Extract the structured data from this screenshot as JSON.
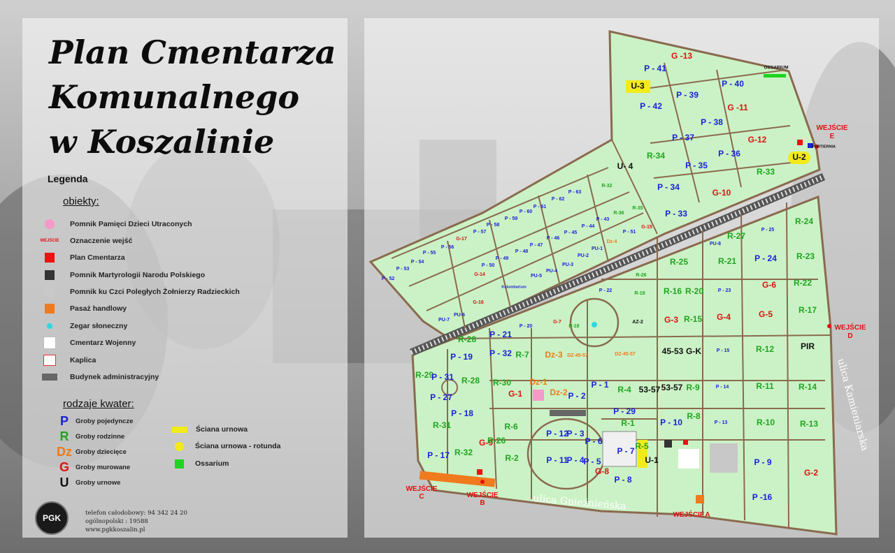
{
  "title": {
    "line1": "Plan Cmentarza",
    "line2": "Komunalnego",
    "line3": "w Koszalinie"
  },
  "legend": {
    "title": "Legenda",
    "objects_heading": "obiekty:",
    "objects": [
      {
        "symbol": "pink-circle",
        "color": "#f49ac8",
        "label": "Pomnik Pamięci Dzieci Utraconych"
      },
      {
        "symbol": "entrance-mark",
        "color": "#e01010",
        "text": "WEJŚCIE",
        "label": "Oznaczenie wejść"
      },
      {
        "symbol": "red-square",
        "color": "#ee1111",
        "label": "Plan Cmentarza"
      },
      {
        "symbol": "dark-square",
        "color": "#333333",
        "label": "Pomnik Martyrologii Narodu Polskiego"
      },
      {
        "symbol": "grey-square",
        "color": "#c8c8c8",
        "label": "Pomnik ku Czci Poległych Żołnierzy Radzieckich"
      },
      {
        "symbol": "orange-square",
        "color": "#f07a1e",
        "label": "Pasaż handlowy"
      },
      {
        "symbol": "cyan-dot",
        "color": "#2fd8e0",
        "label": "Zegar słoneczny"
      },
      {
        "symbol": "war-cemetery-icon",
        "color": "#ffffff",
        "label": "Cmentarz Wojenny"
      },
      {
        "symbol": "chapel-icon",
        "color": "#ffffff",
        "label": "Kaplica"
      },
      {
        "symbol": "admin-building",
        "color": "#666666",
        "label": "Budynek administracyjny"
      }
    ],
    "types_heading": "rodzaje kwater:",
    "types": [
      {
        "letter": "P",
        "color": "#1a22d8",
        "label": "Groby pojedyncze"
      },
      {
        "letter": "R",
        "color": "#1fa51f",
        "label": "Groby rodzinne"
      },
      {
        "letter": "Dz",
        "color": "#ee7a1a",
        "label": "Groby dziecięce"
      },
      {
        "letter": "G",
        "color": "#e01010",
        "label": "Groby murowane"
      },
      {
        "letter": "U",
        "color": "#111111",
        "label": "Groby urnowe"
      }
    ],
    "types_extra": [
      {
        "symbol": "yellow-bar",
        "color": "#f3ea1a",
        "label": "Ściana urnowa"
      },
      {
        "symbol": "yellow-circle",
        "color": "#f3ea1a",
        "label": "Ściana urnowa - rotunda"
      },
      {
        "symbol": "green-square",
        "color": "#1fd41f",
        "label": "Ossarium"
      }
    ]
  },
  "contact": {
    "logo": "PGK",
    "line1": "telefon całodobowy:  94 342 24 20",
    "line2": "ogólnopolski :  19588",
    "line3": "www.pgkkoszalin.pl"
  },
  "map": {
    "streets": [
      "ulica Gnieźnieńska",
      "ulica Kamieniarska"
    ],
    "entrances": [
      {
        "word": "WEJŚCIE",
        "letter": "A"
      },
      {
        "word": "WEJŚCIE",
        "letter": "B"
      },
      {
        "word": "WEJŚCIE",
        "letter": "C"
      },
      {
        "word": "WEJŚCIE",
        "letter": "D"
      },
      {
        "word": "WEJŚCIE",
        "letter": "E"
      }
    ],
    "places": [
      "OSSARIUM",
      "PORTIERNIA",
      "Kolumbarium"
    ],
    "quarters": [
      "G -13",
      "P - 41",
      "U-3",
      "P - 40",
      "P - 39",
      "P - 42",
      "G -11",
      "P - 38",
      "P - 37",
      "G-12",
      "U-2",
      "R-34",
      "P - 36",
      "P - 35",
      "U- 4",
      "R-33",
      "P - 34",
      "G-10",
      "P - 33",
      "R-32",
      "P - 63",
      "P - 62",
      "P - 61",
      "P - 60",
      "P - 59",
      "P - 58",
      "P - 57",
      "G-17",
      "P - 56",
      "P - 55",
      "P - 54",
      "P - 53",
      "P - 52",
      "R-35",
      "R-36",
      "P - 43",
      "P - 44",
      "P - 45",
      "P - 46",
      "P - 47",
      "P - 48",
      "P - 49",
      "P - 50",
      "P - 51",
      "G-15",
      "G-14",
      "G-16",
      "Dz-4",
      "PU-1",
      "PU-2",
      "PU-3",
      "PU-4",
      "PU-5",
      "PU-6",
      "PU-7",
      "PU-8",
      "R-27",
      "P - 25",
      "R-24",
      "R-25",
      "R-21",
      "P - 24",
      "R-23",
      "R-26",
      "P - 22",
      "R-19",
      "R-16",
      "R-20",
      "P - 23",
      "G-6",
      "R-22",
      "G-7",
      "R-18",
      "AZ-2",
      "G-3",
      "R-15",
      "G-4",
      "G-5",
      "R-17",
      "P - 20",
      "P - 21",
      "R-28",
      "P - 32",
      "R-7",
      "Dz-3",
      "DZ-45-57",
      "DZ-45-57",
      "45-53",
      "G-K",
      "P - 15",
      "R-12",
      "PIR",
      "P - 19",
      "R-29",
      "P - 31",
      "R-28",
      "P - 27",
      "R-30",
      "G-1",
      "Dz-1",
      "Dz-2",
      "P - 2",
      "P - 1",
      "R-4",
      "53-57",
      "53-57",
      "R-9",
      "P - 14",
      "R-11",
      "R-14",
      "P - 18",
      "R-31",
      "P - 29",
      "R-1",
      "P - 10",
      "R-8",
      "P - 13",
      "R-10",
      "R-13",
      "P - 17",
      "R-32",
      "G-9",
      "R-26",
      "R-6",
      "P - 12",
      "P - 3",
      "P - 6",
      "P - 7",
      "R-5",
      "U-1",
      "R-2",
      "P - 11",
      "P - 4",
      "P - 5",
      "P - 8",
      "P - 9",
      "G-2",
      "P -16",
      "G-8",
      "R-3"
    ]
  }
}
